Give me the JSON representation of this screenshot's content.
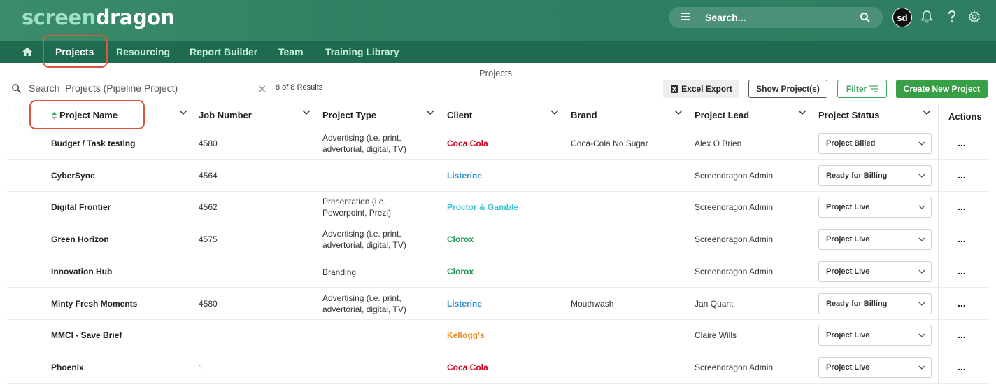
{
  "brand": {
    "logo_part1": "screen",
    "logo_part2": "dragon"
  },
  "header": {
    "search_placeholder": "Search...",
    "avatar_initials": "sd"
  },
  "nav": {
    "items": [
      "Projects",
      "Resourcing",
      "Report Builder",
      "Team",
      "Training Library"
    ]
  },
  "page": {
    "title": "Projects",
    "search_placeholder": "Search  Projects (Pipeline Project)",
    "results_text": "8 of 8 Results"
  },
  "toolbar": {
    "excel_export": "Excel Export",
    "show_projects": "Show Project(s)",
    "filter": "Filter",
    "create_new": "Create New Project"
  },
  "table": {
    "columns": [
      "Project Name",
      "Job Number",
      "Project Type",
      "Client",
      "Brand",
      "Project Lead",
      "Project Status",
      "Actions"
    ],
    "rows": [
      {
        "name": "Budget / Task testing",
        "job": "4580",
        "type": "Advertising (i.e. print, advertorial, digital, TV)",
        "client": "Coca Cola",
        "client_color": "#d0021b",
        "brand": "Coca-Cola No Sugar",
        "lead": "Alex O Brien",
        "status": "Project Billed"
      },
      {
        "name": "CyberSync",
        "job": "4564",
        "type": "",
        "client": "Listerine",
        "client_color": "#2a8fd6",
        "brand": "",
        "lead": "Screendragon Admin",
        "status": "Ready for Billing"
      },
      {
        "name": "Digital Frontier",
        "job": "4562",
        "type": "Presentation (i.e. Powerpoint, Prezi)",
        "client": "Proctor & Gamble",
        "client_color": "#3cc3d3",
        "brand": "",
        "lead": "Screendragon Admin",
        "status": "Project Live"
      },
      {
        "name": "Green Horizon",
        "job": "4575",
        "type": "Advertising (i.e. print, advertorial, digital, TV)",
        "client": "Clorox",
        "client_color": "#1e9a55",
        "brand": "",
        "lead": "Screendragon Admin",
        "status": "Project Live"
      },
      {
        "name": "Innovation Hub",
        "job": "",
        "type": "Branding",
        "client": "Clorox",
        "client_color": "#1e9a55",
        "brand": "",
        "lead": "Screendragon Admin",
        "status": "Project Live"
      },
      {
        "name": "Minty Fresh Moments",
        "job": "4580",
        "type": "Advertising (i.e. print, advertorial, digital, TV)",
        "client": "Listerine",
        "client_color": "#2a8fd6",
        "brand": "Mouthwash",
        "lead": "Jan Quant",
        "status": "Ready for Billing"
      },
      {
        "name": "MMCI - Save Brief",
        "job": "",
        "type": "",
        "client": "Kellogg's",
        "client_color": "#f08a1c",
        "brand": "",
        "lead": "Claire Wills",
        "status": "Project Live"
      },
      {
        "name": "Phoenix",
        "job": "1",
        "type": "",
        "client": "Coca Cola",
        "client_color": "#d0021b",
        "brand": "",
        "lead": "Screendragon Admin",
        "status": "Project Live"
      }
    ],
    "row_action": "..."
  },
  "colors": {
    "header": "#2e8062",
    "nav": "#1f6b4f",
    "accent": "#37a046",
    "highlight": "#d9553d"
  }
}
